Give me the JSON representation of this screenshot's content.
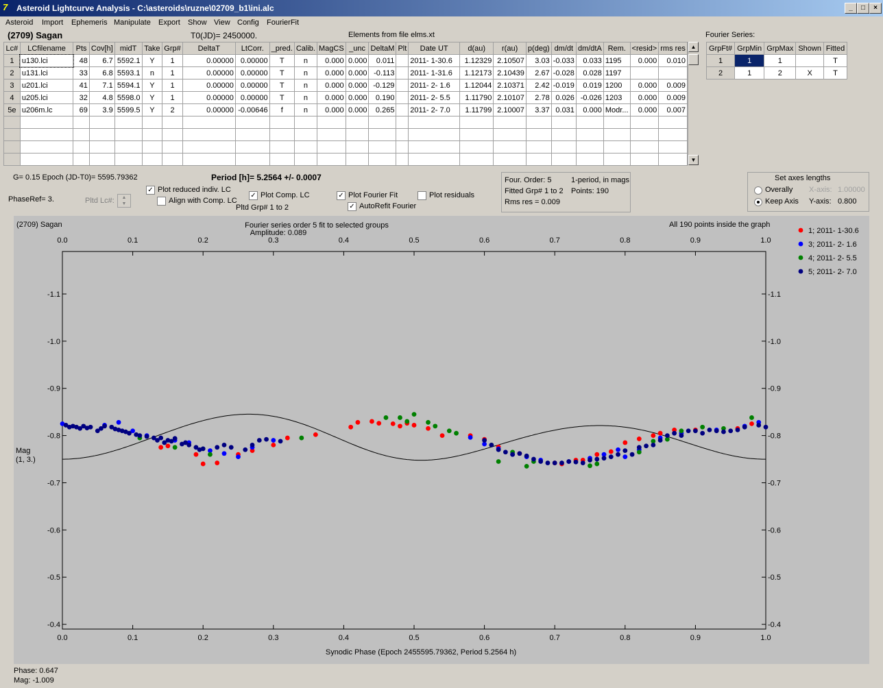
{
  "window": {
    "title": "Asteroid Lightcurve Analysis - C:\\asteroids\\ruzne\\02709_b1\\ini.alc"
  },
  "menu": [
    "Asteroid",
    "Import",
    "Ephemeris",
    "Manipulate",
    "Export",
    "Show",
    "View",
    "Config",
    "FourierFit"
  ],
  "header": {
    "asteroid": "(2709) Sagan",
    "t0": "T0(JD)= 2450000.",
    "elements": "Elements from file elms.xt"
  },
  "lc_table": {
    "columns": [
      "Lc#",
      "LCfilename",
      "Pts",
      "Cov[h]",
      "midT",
      "Take",
      "Grp#",
      "DeltaT",
      "LtCorr.",
      "_pred.",
      "Calib.",
      "MagCS",
      "_unc",
      "DeltaM",
      "Plt",
      "Date UT",
      "d(au)",
      "r(au)",
      "p(deg)",
      "dm/dt",
      "dm/dtA",
      "Rem.",
      "<resid>",
      "rms res"
    ],
    "rows": [
      [
        "1",
        "u130.lci",
        "48",
        "6.7",
        "5592.1",
        "Y",
        "1",
        "0.00000",
        "0.00000",
        "T",
        "n",
        "0.000",
        "0.000",
        "0.011",
        "",
        "2011- 1-30.6",
        "1.12329",
        "2.10507",
        "3.03",
        "-0.033",
        "0.033",
        "1195",
        "0.000",
        "0.010"
      ],
      [
        "2",
        "u131.lci",
        "33",
        "6.8",
        "5593.1",
        "n",
        "1",
        "0.00000",
        "0.00000",
        "T",
        "n",
        "0.000",
        "0.000",
        "-0.113",
        "",
        "2011- 1-31.6",
        "1.12173",
        "2.10439",
        "2.67",
        "-0.028",
        "0.028",
        "1197",
        "",
        ""
      ],
      [
        "3",
        "u201.lci",
        "41",
        "7.1",
        "5594.1",
        "Y",
        "1",
        "0.00000",
        "0.00000",
        "T",
        "n",
        "0.000",
        "0.000",
        "-0.129",
        "",
        "2011- 2- 1.6",
        "1.12044",
        "2.10371",
        "2.42",
        "-0.019",
        "0.019",
        "1200",
        "0.000",
        "0.009"
      ],
      [
        "4",
        "u205.lci",
        "32",
        "4.8",
        "5598.0",
        "Y",
        "1",
        "0.00000",
        "0.00000",
        "T",
        "n",
        "0.000",
        "0.000",
        "0.190",
        "",
        "2011- 2- 5.5",
        "1.11790",
        "2.10107",
        "2.78",
        "0.026",
        "-0.026",
        "1203",
        "0.000",
        "0.009"
      ],
      [
        "5e",
        "u206m.lc",
        "69",
        "3.9",
        "5599.5",
        "Y",
        "2",
        "0.00000",
        "-0.00646",
        "f",
        "n",
        "0.000",
        "0.000",
        "0.265",
        "",
        "2011- 2- 7.0",
        "1.11799",
        "2.10007",
        "3.37",
        "0.031",
        "0.000",
        "Modr...",
        "0.000",
        "0.007"
      ]
    ],
    "empty_rows": 4
  },
  "fourier_series": {
    "title": "Fourier Series:",
    "columns": [
      "GrpFt#",
      "GrpMin",
      "GrpMax",
      "Shown",
      "Fitted"
    ],
    "rows": [
      [
        "1",
        "1",
        "1",
        "",
        "T"
      ],
      [
        "2",
        "1",
        "2",
        "X",
        "T"
      ]
    ]
  },
  "info": {
    "g_epoch": "G= 0.15   Epoch (JD-T0)= 5595.79362",
    "period": "Period [h]= 5.2564 +/- 0.0007",
    "phaseref": "PhaseRef= 3.",
    "pltd_lc": "Pltd Lc#:",
    "pltd_grp": "Pltd Grp#  1   to   2"
  },
  "checks": [
    {
      "label": "Plot reduced indiv. LC",
      "checked": true
    },
    {
      "label": "Align with Comp. LC",
      "checked": false
    },
    {
      "label": "Plot Comp. LC",
      "checked": true
    },
    {
      "label": "Plot Fourier Fit",
      "checked": true
    },
    {
      "label": "AutoRefit Fourier",
      "checked": true
    },
    {
      "label": "Plot residuals",
      "checked": false
    }
  ],
  "fit_box": {
    "order": "Four. Order:  5",
    "mode": "1-period, in mags",
    "fitted": "Fitted Grp# 1 to 2",
    "points": "Points: 190",
    "rms": "Rms res     = 0.009"
  },
  "axes_box": {
    "title": "Set axes lengths",
    "overally": "Overally",
    "keep": "Keep Axis",
    "xaxis": "X-axis:",
    "xval": "1.00000",
    "yaxis": "Y-axis:",
    "yval": "0.800"
  },
  "chart_data": {
    "type": "scatter",
    "title": "(2709) Sagan",
    "subtitle": "Fourier series order 5 fit to selected groups",
    "amplitude": "Amplitude: 0.089",
    "note": "All 190 points inside the graph",
    "xlabel": "Synodic Phase (Epoch 2455595.79362, Period 5.2564 h)",
    "ylabel": "Mag",
    "ylabel2": "(1, 3.)",
    "xlim": [
      0,
      1
    ],
    "ylim": [
      -0.39,
      -1.19
    ],
    "y_reversed": true,
    "x_ticks": [
      "0.0",
      "0.1",
      "0.2",
      "0.3",
      "0.4",
      "0.5",
      "0.6",
      "0.7",
      "0.8",
      "0.9",
      "1.0"
    ],
    "y_ticks": [
      -1.1,
      -1.0,
      -0.9,
      -0.8,
      -0.7,
      -0.6,
      -0.5,
      -0.4
    ],
    "y_tick_labels": [
      "-1.1",
      "-1.0",
      "-0.9",
      "-0.8",
      "-0.7",
      "-0.6",
      "-0.5",
      "-0.4"
    ],
    "legend_position": "top-right",
    "series": [
      {
        "name": "1; 2011- 1-30.6",
        "color": "#ff0000",
        "points": [
          [
            0.14,
            -0.775
          ],
          [
            0.15,
            -0.778
          ],
          [
            0.19,
            -0.76
          ],
          [
            0.2,
            -0.74
          ],
          [
            0.22,
            -0.742
          ],
          [
            0.25,
            -0.76
          ],
          [
            0.27,
            -0.768
          ],
          [
            0.3,
            -0.78
          ],
          [
            0.32,
            -0.795
          ],
          [
            0.36,
            -0.802
          ],
          [
            0.41,
            -0.818
          ],
          [
            0.42,
            -0.828
          ],
          [
            0.44,
            -0.83
          ],
          [
            0.45,
            -0.826
          ],
          [
            0.47,
            -0.825
          ],
          [
            0.48,
            -0.82
          ],
          [
            0.49,
            -0.826
          ],
          [
            0.5,
            -0.822
          ],
          [
            0.52,
            -0.815
          ],
          [
            0.54,
            -0.8
          ],
          [
            0.58,
            -0.8
          ],
          [
            0.6,
            -0.792
          ],
          [
            0.62,
            -0.776
          ],
          [
            0.65,
            -0.762
          ],
          [
            0.7,
            -0.742
          ],
          [
            0.71,
            -0.74
          ],
          [
            0.73,
            -0.748
          ],
          [
            0.74,
            -0.748
          ],
          [
            0.76,
            -0.76
          ],
          [
            0.78,
            -0.766
          ],
          [
            0.8,
            -0.785
          ],
          [
            0.82,
            -0.793
          ],
          [
            0.84,
            -0.8
          ],
          [
            0.85,
            -0.805
          ],
          [
            0.87,
            -0.812
          ],
          [
            0.9,
            -0.812
          ],
          [
            0.96,
            -0.815
          ],
          [
            0.98,
            -0.825
          ]
        ]
      },
      {
        "name": "3; 2011- 2- 1.6",
        "color": "#0000ff",
        "points": [
          [
            0.0,
            -0.825
          ],
          [
            0.06,
            -0.822
          ],
          [
            0.08,
            -0.828
          ],
          [
            0.1,
            -0.81
          ],
          [
            0.12,
            -0.8
          ],
          [
            0.16,
            -0.79
          ],
          [
            0.18,
            -0.785
          ],
          [
            0.21,
            -0.768
          ],
          [
            0.23,
            -0.762
          ],
          [
            0.25,
            -0.755
          ],
          [
            0.27,
            -0.775
          ],
          [
            0.3,
            -0.79
          ],
          [
            0.58,
            -0.796
          ],
          [
            0.6,
            -0.782
          ],
          [
            0.62,
            -0.772
          ],
          [
            0.64,
            -0.76
          ],
          [
            0.66,
            -0.755
          ],
          [
            0.68,
            -0.748
          ],
          [
            0.72,
            -0.745
          ],
          [
            0.75,
            -0.752
          ],
          [
            0.77,
            -0.76
          ],
          [
            0.79,
            -0.77
          ],
          [
            0.8,
            -0.755
          ],
          [
            0.82,
            -0.77
          ],
          [
            0.85,
            -0.795
          ],
          [
            0.88,
            -0.805
          ],
          [
            0.93,
            -0.812
          ],
          [
            0.97,
            -0.82
          ],
          [
            0.99,
            -0.828
          ]
        ]
      },
      {
        "name": "4; 2011- 2- 5.5",
        "color": "#008000",
        "points": [
          [
            0.11,
            -0.795
          ],
          [
            0.16,
            -0.775
          ],
          [
            0.2,
            -0.772
          ],
          [
            0.21,
            -0.76
          ],
          [
            0.34,
            -0.795
          ],
          [
            0.46,
            -0.838
          ],
          [
            0.48,
            -0.838
          ],
          [
            0.49,
            -0.83
          ],
          [
            0.5,
            -0.845
          ],
          [
            0.52,
            -0.828
          ],
          [
            0.53,
            -0.82
          ],
          [
            0.55,
            -0.81
          ],
          [
            0.56,
            -0.805
          ],
          [
            0.61,
            -0.78
          ],
          [
            0.62,
            -0.745
          ],
          [
            0.64,
            -0.765
          ],
          [
            0.66,
            -0.735
          ],
          [
            0.67,
            -0.745
          ],
          [
            0.75,
            -0.736
          ],
          [
            0.76,
            -0.74
          ],
          [
            0.82,
            -0.765
          ],
          [
            0.84,
            -0.788
          ],
          [
            0.86,
            -0.792
          ],
          [
            0.88,
            -0.81
          ],
          [
            0.91,
            -0.818
          ],
          [
            0.94,
            -0.815
          ],
          [
            0.98,
            -0.838
          ]
        ]
      },
      {
        "name": "5; 2011- 2- 7.0",
        "color": "#000080",
        "points": [
          [
            0.005,
            -0.822
          ],
          [
            0.01,
            -0.818
          ],
          [
            0.015,
            -0.82
          ],
          [
            0.02,
            -0.818
          ],
          [
            0.025,
            -0.815
          ],
          [
            0.03,
            -0.82
          ],
          [
            0.035,
            -0.816
          ],
          [
            0.04,
            -0.818
          ],
          [
            0.05,
            -0.81
          ],
          [
            0.055,
            -0.815
          ],
          [
            0.06,
            -0.82
          ],
          [
            0.07,
            -0.818
          ],
          [
            0.075,
            -0.814
          ],
          [
            0.08,
            -0.812
          ],
          [
            0.085,
            -0.81
          ],
          [
            0.09,
            -0.808
          ],
          [
            0.095,
            -0.805
          ],
          [
            0.105,
            -0.802
          ],
          [
            0.11,
            -0.8
          ],
          [
            0.12,
            -0.798
          ],
          [
            0.13,
            -0.795
          ],
          [
            0.135,
            -0.79
          ],
          [
            0.14,
            -0.795
          ],
          [
            0.145,
            -0.785
          ],
          [
            0.15,
            -0.79
          ],
          [
            0.155,
            -0.788
          ],
          [
            0.16,
            -0.794
          ],
          [
            0.17,
            -0.782
          ],
          [
            0.175,
            -0.785
          ],
          [
            0.18,
            -0.78
          ],
          [
            0.19,
            -0.775
          ],
          [
            0.195,
            -0.77
          ],
          [
            0.2,
            -0.772
          ],
          [
            0.22,
            -0.775
          ],
          [
            0.23,
            -0.78
          ],
          [
            0.24,
            -0.775
          ],
          [
            0.26,
            -0.77
          ],
          [
            0.27,
            -0.78
          ],
          [
            0.28,
            -0.79
          ],
          [
            0.29,
            -0.792
          ],
          [
            0.31,
            -0.788
          ],
          [
            0.6,
            -0.79
          ],
          [
            0.61,
            -0.78
          ],
          [
            0.62,
            -0.77
          ],
          [
            0.63,
            -0.765
          ],
          [
            0.64,
            -0.76
          ],
          [
            0.65,
            -0.762
          ],
          [
            0.66,
            -0.757
          ],
          [
            0.67,
            -0.75
          ],
          [
            0.68,
            -0.745
          ],
          [
            0.69,
            -0.742
          ],
          [
            0.7,
            -0.742
          ],
          [
            0.71,
            -0.742
          ],
          [
            0.72,
            -0.745
          ],
          [
            0.73,
            -0.744
          ],
          [
            0.74,
            -0.742
          ],
          [
            0.75,
            -0.748
          ],
          [
            0.76,
            -0.75
          ],
          [
            0.77,
            -0.752
          ],
          [
            0.78,
            -0.755
          ],
          [
            0.79,
            -0.76
          ],
          [
            0.8,
            -0.768
          ],
          [
            0.81,
            -0.76
          ],
          [
            0.82,
            -0.775
          ],
          [
            0.83,
            -0.778
          ],
          [
            0.84,
            -0.78
          ],
          [
            0.85,
            -0.79
          ],
          [
            0.86,
            -0.8
          ],
          [
            0.87,
            -0.805
          ],
          [
            0.88,
            -0.8
          ],
          [
            0.89,
            -0.81
          ],
          [
            0.9,
            -0.81
          ],
          [
            0.91,
            -0.805
          ],
          [
            0.92,
            -0.812
          ],
          [
            0.93,
            -0.81
          ],
          [
            0.94,
            -0.808
          ],
          [
            0.95,
            -0.81
          ],
          [
            0.96,
            -0.812
          ],
          [
            0.97,
            -0.818
          ],
          [
            0.99,
            -0.822
          ],
          [
            1.0,
            -0.818
          ]
        ]
      }
    ],
    "fit_curve": {
      "mean": -0.792,
      "a1": 0.0,
      "b1": -0.0105,
      "a2": 0.0418,
      "b2": 0.0049,
      "a3": -0.0009,
      "b3": 0.0014,
      "a4": 0.0012,
      "b4": -0.001,
      "a5": 0.0,
      "b5": 0.0
    }
  },
  "status": {
    "phase": "Phase:  0.647",
    "mag": "Mag:    -1.009"
  },
  "colors": {
    "plot_bg": "#c0c0c0",
    "panel": "#d4d0c8",
    "title_bar": "#0a246a"
  }
}
